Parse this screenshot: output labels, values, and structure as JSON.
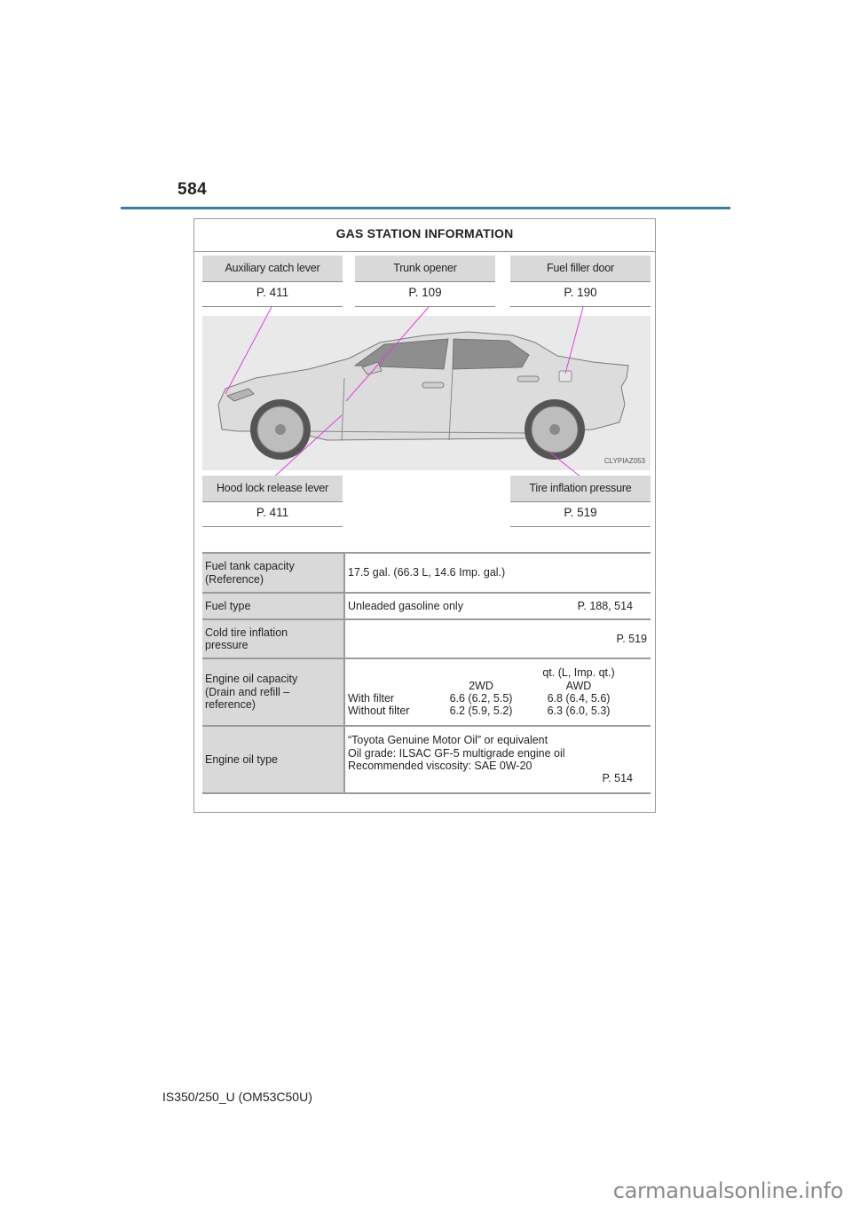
{
  "page_number": "584",
  "section_title": "GAS STATION INFORMATION",
  "callouts_top": [
    {
      "label": "Auxiliary catch lever",
      "ref": "P. 411"
    },
    {
      "label": "Trunk opener",
      "ref": "P. 109"
    },
    {
      "label": "Fuel filler door",
      "ref": "P. 190"
    }
  ],
  "callouts_bottom": [
    {
      "label": "Hood lock release lever",
      "ref": "P. 411"
    },
    {
      "label": "Tire inflation pressure",
      "ref": "P. 519"
    }
  ],
  "illustration": {
    "id": "CLYPIAZ053",
    "subject": "car-side-view",
    "callout_line_color": "#e040e0"
  },
  "specs": {
    "fuel_tank": {
      "key_line1": "Fuel tank capacity",
      "key_line2": "(Reference)",
      "value": "17.5 gal. (66.3 L, 14.6 Imp. gal.)"
    },
    "fuel_type": {
      "key": "Fuel type",
      "value": "Unleaded gasoline only",
      "ref": "P. 188, 514"
    },
    "cold_tire": {
      "key_line1": "Cold tire inflation",
      "key_line2": "pressure",
      "ref": "P. 519"
    },
    "engine_oil_capacity": {
      "key_line1": "Engine oil capacity",
      "key_line2": "(Drain and refill –",
      "key_line3": "reference)",
      "units": "qt. (L, Imp. qt.)",
      "col_2wd": "2WD",
      "col_awd": "AWD",
      "rows": [
        {
          "label": "With filter",
          "v2wd": "6.6 (6.2, 5.5)",
          "vawd": "6.8 (6.4, 5.6)"
        },
        {
          "label": "Without filter",
          "v2wd": "6.2 (5.9, 5.2)",
          "vawd": "6.3 (6.0, 5.3)"
        }
      ]
    },
    "engine_oil_type": {
      "key": "Engine oil type",
      "line1": "“Toyota Genuine Motor Oil” or equivalent",
      "line2": "Oil grade: ILSAC GF-5 multigrade engine oil",
      "line3": "Recommended viscosity: SAE 0W-20",
      "ref": "P. 514"
    }
  },
  "footer": "IS350/250_U (OM53C50U)",
  "watermark": "carmanualsonline.info",
  "colors": {
    "header_rule": "#3a7f9e",
    "label_bg": "#d9d9d9",
    "callout_line": "#e040e0"
  }
}
